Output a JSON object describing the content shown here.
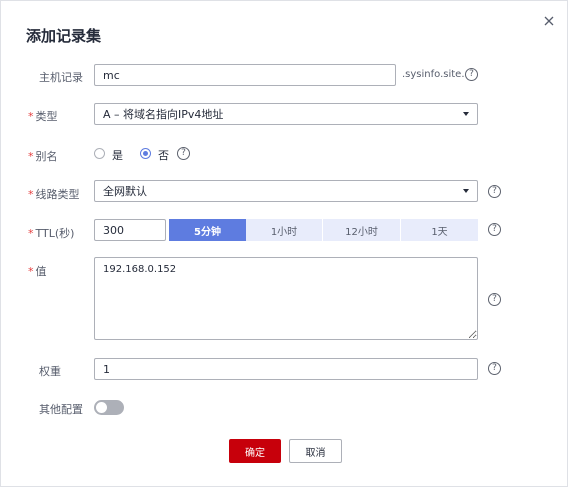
{
  "dialog": {
    "title": "添加记录集",
    "close_glyph": "✕"
  },
  "fields": {
    "host": {
      "label": "主机记录",
      "value": "mc",
      "suffix": ".sysinfo.site."
    },
    "type": {
      "required_mark": "*",
      "label": "类型",
      "value": "A – 将域名指向IPv4地址"
    },
    "alias": {
      "required_mark": "*",
      "label": "别名",
      "options": [
        "是",
        "否"
      ],
      "selected": "否"
    },
    "line": {
      "required_mark": "*",
      "label": "线路类型",
      "value": "全网默认"
    },
    "ttl": {
      "required_mark": "*",
      "label": "TTL(秒)",
      "value": "300",
      "presets": [
        "5分钟",
        "1小时",
        "12小时",
        "1天"
      ],
      "active_preset": "5分钟"
    },
    "record_value": {
      "required_mark": "*",
      "label": "值",
      "value": "192.168.0.152"
    },
    "weight": {
      "label": "权重",
      "value": "1"
    },
    "advanced": {
      "label": "其他配置",
      "enabled": false
    }
  },
  "help_glyph": "?",
  "buttons": {
    "confirm": "确定",
    "cancel": "取消"
  },
  "colors": {
    "primary": "#c7000b",
    "accent": "#5e7ce0",
    "required": "#e53e3e",
    "segment_bg": "#e8ecfb"
  }
}
